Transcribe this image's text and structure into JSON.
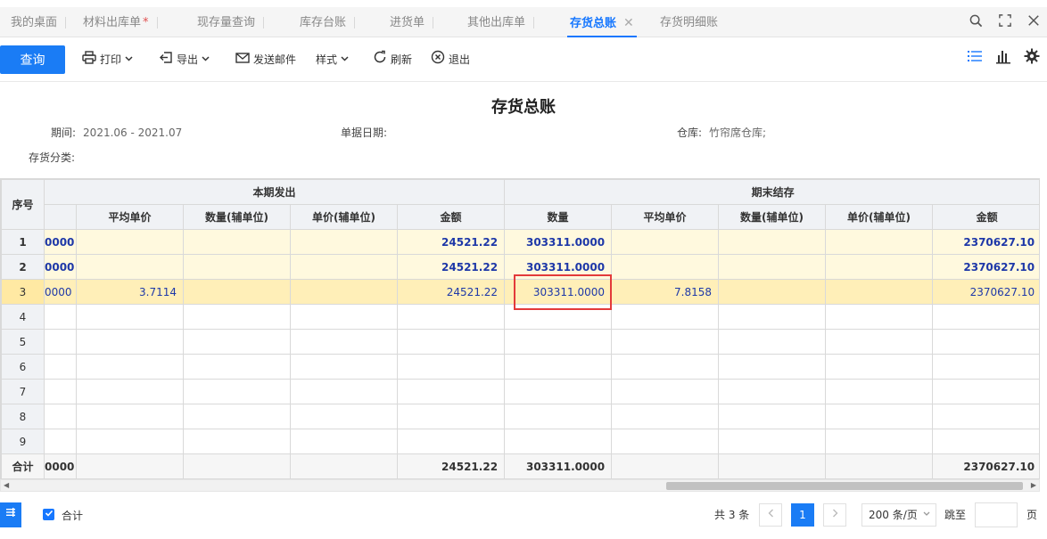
{
  "tabs": [
    {
      "label": "我的桌面",
      "active": false,
      "dirty": false
    },
    {
      "label": "材料出库单",
      "active": false,
      "dirty": true
    },
    {
      "label": "现存量查询",
      "active": false,
      "dirty": false
    },
    {
      "label": "库存台账",
      "active": false,
      "dirty": false
    },
    {
      "label": "进货单",
      "active": false,
      "dirty": false
    },
    {
      "label": "其他出库单",
      "active": false,
      "dirty": false
    },
    {
      "label": "存货总账",
      "active": true,
      "dirty": false
    },
    {
      "label": "存货明细账",
      "active": false,
      "dirty": false
    }
  ],
  "tab_dirty_mark": "*",
  "tab_close_glyph": "✕",
  "window_icons": [
    "search-icon",
    "fullscreen-icon",
    "close-icon"
  ],
  "toolbar": {
    "query_label": "查询",
    "print_label": "打印",
    "export_label": "导出",
    "email_label": "发送邮件",
    "style_label": "样式",
    "refresh_label": "刷新",
    "exit_label": "退出",
    "right_icons": [
      "list-view-icon",
      "chart-view-icon",
      "settings-icon"
    ]
  },
  "report": {
    "title": "存货总账",
    "period_label": "期间:",
    "period_value": "2021.06 - 2021.07",
    "doc_date_label": "单据日期:",
    "warehouse_label": "仓库:",
    "warehouse_value": "竹帘席仓库;",
    "category_label": "存货分类:"
  },
  "table": {
    "seq_header": "序号",
    "group_headers": [
      "本期发出",
      "期末结存"
    ],
    "columns": [
      "平均单价",
      "数量(辅单位)",
      "单价(辅单位)",
      "金额",
      "数量",
      "平均单价",
      "数量(辅单位)",
      "单价(辅单位)",
      "金额"
    ],
    "rows": [
      {
        "seq": "1",
        "cells": [
          "0000",
          "",
          "",
          "",
          "24521.22",
          "303311.0000",
          "",
          "",
          "",
          "2370627.10"
        ]
      },
      {
        "seq": "2",
        "cells": [
          "0000",
          "",
          "",
          "",
          "24521.22",
          "303311.0000",
          "",
          "",
          "",
          "2370627.10"
        ]
      },
      {
        "seq": "3",
        "cells": [
          "0000",
          "3.7114",
          "",
          "",
          "24521.22",
          "303311.0000",
          "7.8158",
          "",
          "",
          "2370627.10"
        ]
      },
      {
        "seq": "4",
        "cells": [
          "",
          "",
          "",
          "",
          "",
          "",
          "",
          "",
          "",
          ""
        ]
      },
      {
        "seq": "5",
        "cells": [
          "",
          "",
          "",
          "",
          "",
          "",
          "",
          "",
          "",
          ""
        ]
      },
      {
        "seq": "6",
        "cells": [
          "",
          "",
          "",
          "",
          "",
          "",
          "",
          "",
          "",
          ""
        ]
      },
      {
        "seq": "7",
        "cells": [
          "",
          "",
          "",
          "",
          "",
          "",
          "",
          "",
          "",
          ""
        ]
      },
      {
        "seq": "8",
        "cells": [
          "",
          "",
          "",
          "",
          "",
          "",
          "",
          "",
          "",
          ""
        ]
      },
      {
        "seq": "9",
        "cells": [
          "",
          "",
          "",
          "",
          "",
          "",
          "",
          "",
          "",
          ""
        ]
      }
    ],
    "total_row": {
      "seq": "合计",
      "cells": [
        "0000",
        "",
        "",
        "",
        "24521.22",
        "303311.0000",
        "",
        "",
        "",
        "2370627.10"
      ]
    }
  },
  "footer": {
    "sum_checkbox_label": "合计",
    "total_count_text": "共 3 条",
    "current_page": "1",
    "page_size": "200 条/页",
    "jump_label": "跳至",
    "page_unit": "页"
  },
  "colors": {
    "accent": "#1a7cf5",
    "number_text": "#1e38a8",
    "highlight_box": "#e33a3a",
    "row_highlight": "#fff9de"
  }
}
